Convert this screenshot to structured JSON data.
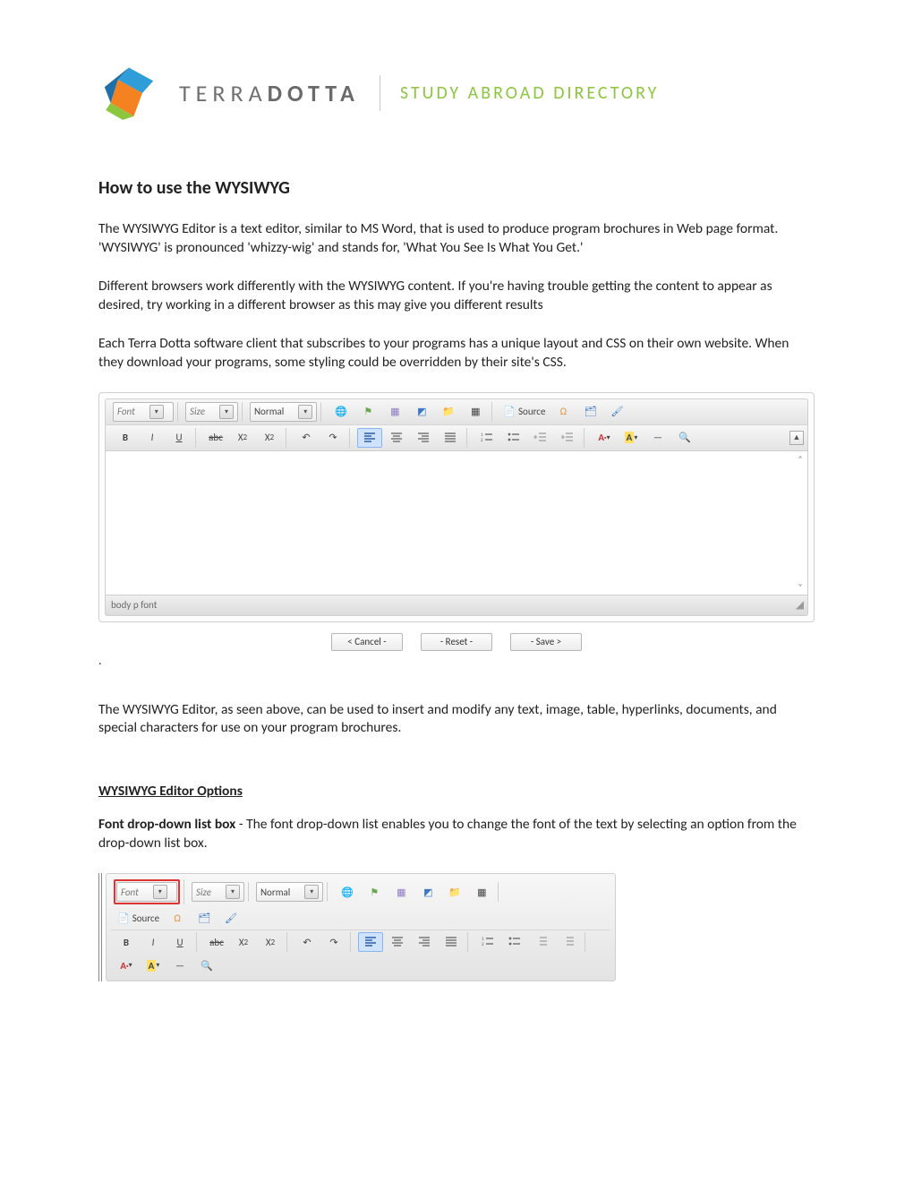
{
  "brand": {
    "name_light": "TERRA",
    "name_bold": "DOTTA",
    "tagline": "STUDY ABROAD DIRECTORY"
  },
  "title": "How to use the WYSIWYG",
  "paragraphs": {
    "p1": "The WYSIWYG Editor is a text editor, similar to MS Word, that is used to produce program brochures in Web page format.  'WYSIWYG' is pronounced 'whizzy-wig' and stands for, 'What You See Is What You Get.'",
    "p2": "Different browsers work differently with the WYSIWYG content.  If you're having trouble getting the content to appear as desired, try working in a different browser as this may give you different results",
    "p3": "Each Terra Dotta software client that subscribes to your programs has a unique layout and CSS on their own website.  When they download your programs, some styling could be overridden by their site's CSS.",
    "p4": "The WYSIWYG Editor, as seen above, can be used to insert and modify any text, image, table, hyperlinks, documents, and special characters for use on your program brochures."
  },
  "editor": {
    "font_label": "Font",
    "size_label": "Size",
    "format_label": "Normal",
    "source_label": "Source",
    "status_path": "body p font",
    "buttons": {
      "cancel": "< Cancel -",
      "reset": "- Reset -",
      "save": "- Save >"
    },
    "row2": {
      "bold": "B",
      "italic": "I",
      "underline": "U",
      "strike": "abc",
      "sub": "X",
      "sub2": "2",
      "sup": "X",
      "sup2": "2",
      "undo_glyph": "↶",
      "redo_glyph": "↷"
    }
  },
  "options": {
    "heading": "WYSIWYG Editor Options",
    "font_label": "Font drop-down list box",
    "font_desc": " - The font drop-down list enables you to change the font of the text by selecting an option from the drop-down list box."
  }
}
